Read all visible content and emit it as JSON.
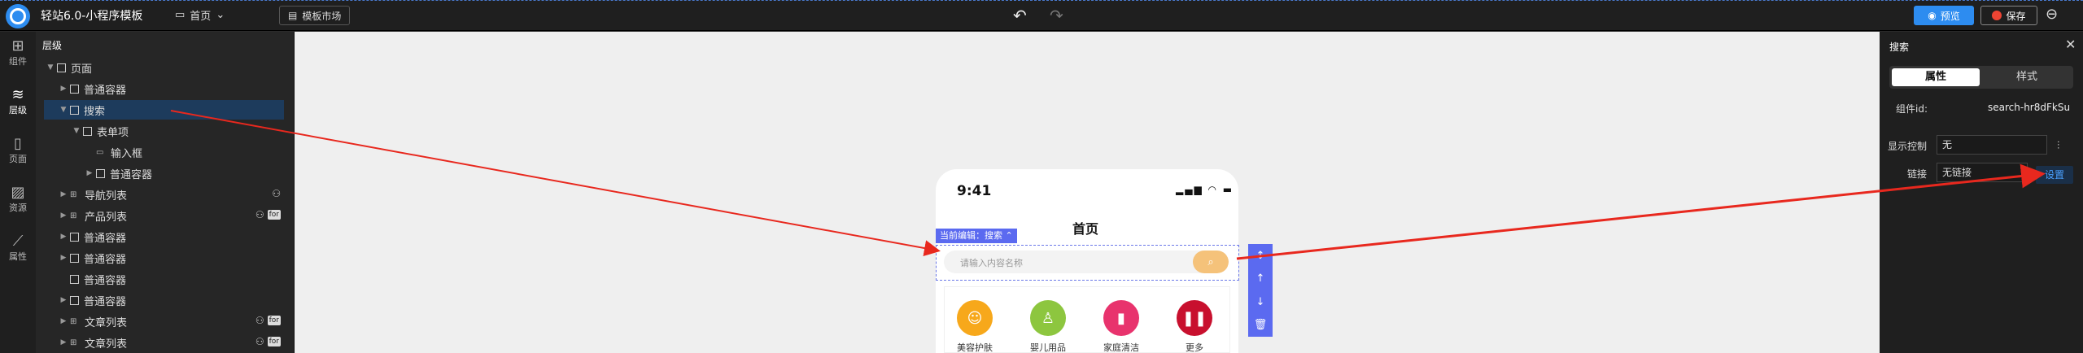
{
  "header": {
    "app_title": "轻站6.0-小程序模板",
    "page_selector": "首页",
    "template_market": "模板市场",
    "preview_label": "预览",
    "save_label": "保存",
    "undo_icon": "undo-icon",
    "redo_icon": "redo-icon"
  },
  "rail": {
    "items": [
      {
        "label": "组件",
        "icon": "grid-icon"
      },
      {
        "label": "层级",
        "icon": "layers-icon"
      },
      {
        "label": "页面",
        "icon": "page-icon"
      },
      {
        "label": "资源",
        "icon": "image-icon"
      },
      {
        "label": "属性",
        "icon": "wand-icon"
      }
    ]
  },
  "layers": {
    "title": "层级",
    "items": [
      {
        "label": "页面"
      },
      {
        "label": "普通容器"
      },
      {
        "label": "搜索"
      },
      {
        "label": "表单项"
      },
      {
        "label": "输入框"
      },
      {
        "label": "普通容器"
      },
      {
        "label": "导航列表"
      },
      {
        "label": "产品列表",
        "badge": "for"
      },
      {
        "label": "普通容器"
      },
      {
        "label": "普通容器"
      },
      {
        "label": "普通容器"
      },
      {
        "label": "普通容器"
      },
      {
        "label": "文章列表",
        "badge": "for"
      },
      {
        "label": "文章列表",
        "badge": "for"
      }
    ]
  },
  "canvas": {
    "time": "9:41",
    "page_title": "首页",
    "current_edit": "当前编辑：搜索",
    "search_placeholder": "请输入内容名称",
    "categories": [
      {
        "label": "美容护肤",
        "color": "#f7a81b"
      },
      {
        "label": "婴儿用品",
        "color": "#8dc63f"
      },
      {
        "label": "家庭清洁",
        "color": "#e8336d"
      },
      {
        "label": "更多",
        "color": "#c8102e"
      }
    ]
  },
  "props": {
    "title": "搜索",
    "tab_attr": "属性",
    "tab_style": "样式",
    "id_label": "组件id:",
    "id_value": "search-hr8dFkSu",
    "display_label": "显示控制",
    "display_value": "无",
    "link_label": "链接",
    "link_value": "无链接",
    "set_button": "设置"
  },
  "colors": {
    "accent": "#2d8cf0",
    "selection": "#5b6af0",
    "arrow": "#e8281e"
  }
}
